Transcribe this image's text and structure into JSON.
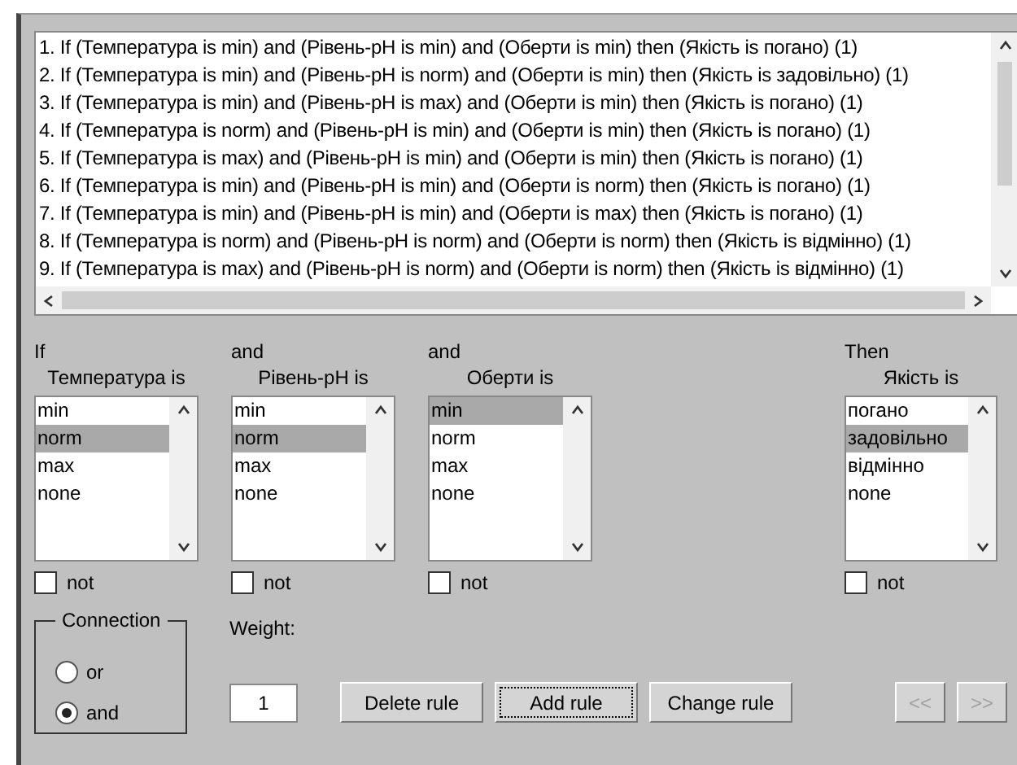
{
  "rules": [
    "1. If (Температура is min) and (Рівень-pH is min) and (Оберти is min) then (Якість is погано) (1)",
    "2. If (Температура is min) and (Рівень-pH is norm) and (Оберти is min) then (Якість is задовільно) (1)",
    "3. If (Температура is min) and (Рівень-pH is max) and (Оберти is min) then (Якість is погано) (1)",
    "4. If (Температура is norm) and (Рівень-pH is min) and (Оберти is min) then (Якість is погано) (1)",
    "5. If (Температура is max) and (Рівень-pH is min) and (Оберти is min) then (Якість is погано) (1)",
    "6. If (Температура is min) and (Рівень-pH is min) and (Оберти is norm) then (Якість is погано) (1)",
    "7. If (Температура is min) and (Рівень-pH is min) and (Оберти is max) then (Якість is погано) (1)",
    "8. If (Температура is norm) and (Рівень-pH is norm) and (Оберти is norm) then (Якість is відмінно) (1)",
    "9. If (Температура is max) and (Рівень-pH is norm) and (Оберти is norm) then (Якість is відмінно) (1)"
  ],
  "variables": [
    {
      "kind": "input",
      "header": "If",
      "label": "Температура is",
      "not_label": "not",
      "not": false,
      "options": [
        {
          "text": "min",
          "selected": false
        },
        {
          "text": "norm",
          "selected": true
        },
        {
          "text": "max",
          "selected": false
        },
        {
          "text": "none",
          "selected": false
        }
      ]
    },
    {
      "kind": "input",
      "header": "and",
      "label": "Рівень-pH is",
      "not_label": "not",
      "not": false,
      "options": [
        {
          "text": "min",
          "selected": false
        },
        {
          "text": "norm",
          "selected": true
        },
        {
          "text": "max",
          "selected": false
        },
        {
          "text": "none",
          "selected": false
        }
      ]
    },
    {
      "kind": "input",
      "header": "and",
      "label": "Оберти is",
      "not_label": "not",
      "not": false,
      "options": [
        {
          "text": "min",
          "selected": true
        },
        {
          "text": "norm",
          "selected": false
        },
        {
          "text": "max",
          "selected": false
        },
        {
          "text": "none",
          "selected": false
        }
      ]
    },
    {
      "kind": "output",
      "header": "Then",
      "label": "Якість is",
      "not_label": "not",
      "not": false,
      "options": [
        {
          "text": "погано",
          "selected": false
        },
        {
          "text": "задовільно",
          "selected": true
        },
        {
          "text": "відмінно",
          "selected": false
        },
        {
          "text": "none",
          "selected": false
        }
      ]
    }
  ],
  "connection": {
    "title": "Connection",
    "options": [
      {
        "label": "or",
        "selected": false
      },
      {
        "label": "and",
        "selected": true
      }
    ]
  },
  "weight": {
    "label": "Weight:",
    "value": "1"
  },
  "buttons": [
    {
      "label": "Delete rule",
      "focused": false
    },
    {
      "label": "Add rule",
      "focused": true
    },
    {
      "label": "Change rule",
      "focused": false
    }
  ],
  "nav_buttons": [
    {
      "label": "<<",
      "disabled": true
    },
    {
      "label": ">>",
      "disabled": true
    }
  ]
}
